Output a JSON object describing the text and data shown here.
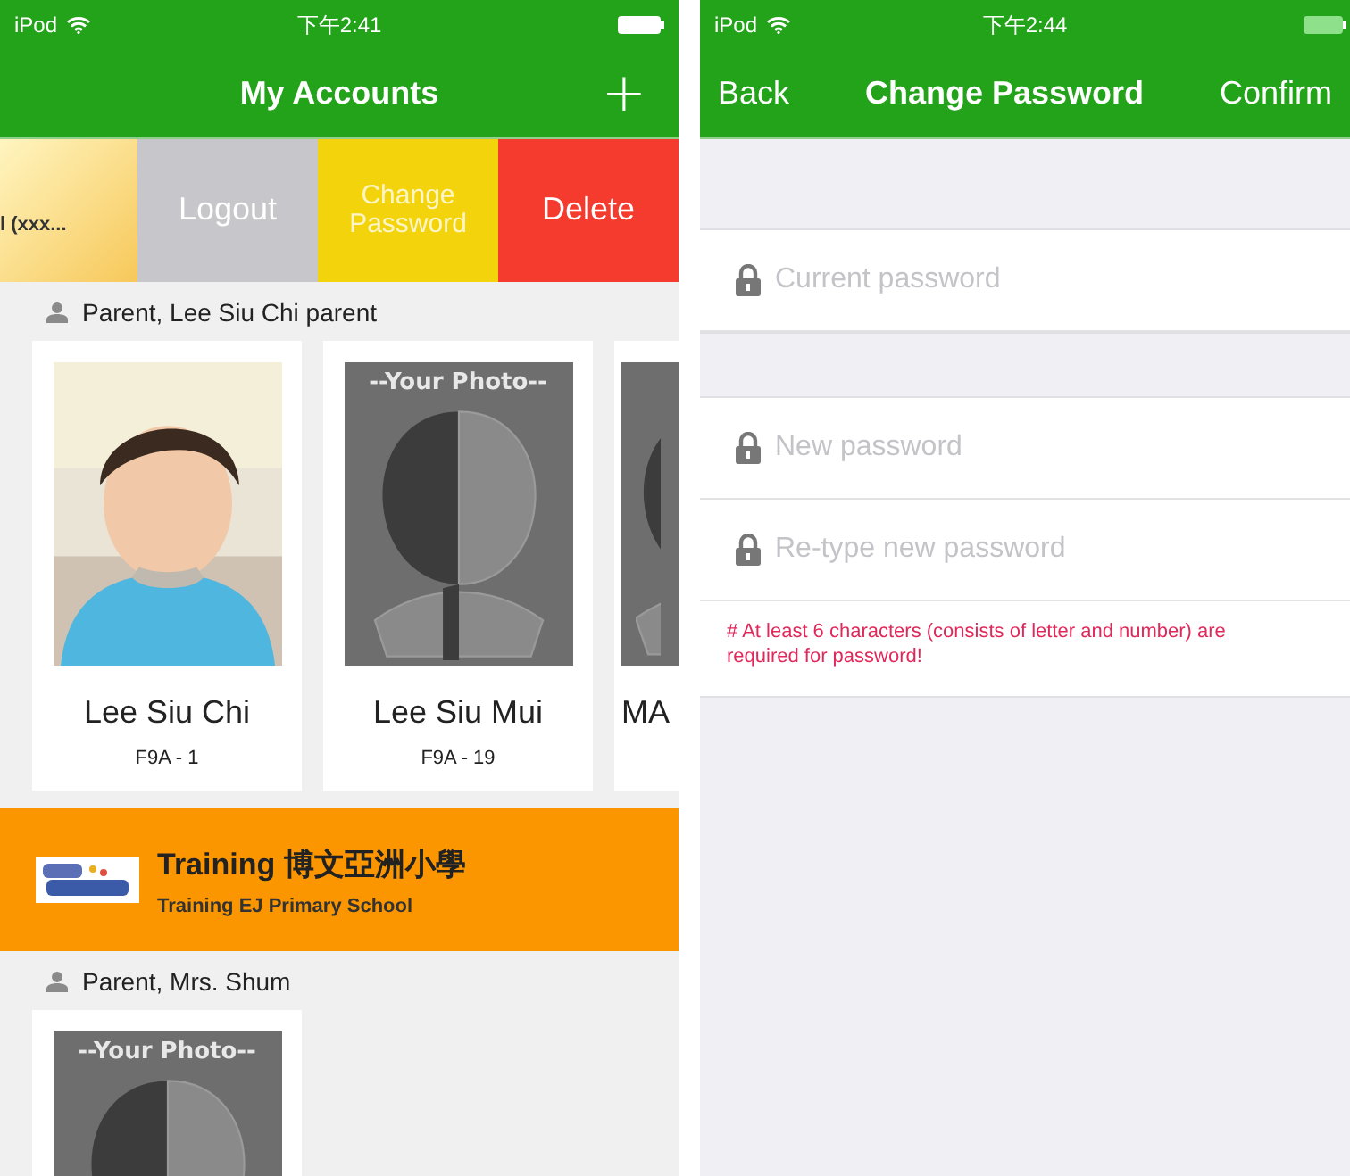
{
  "accounts_screen": {
    "status_bar": {
      "carrier": "iPod",
      "time": "下午2:41"
    },
    "title": "My Accounts",
    "add_button": "+",
    "swipe_row": {
      "partial_text": "l (xxx...",
      "actions": [
        {
          "label": "Logout",
          "color": "#c6c6cb"
        },
        {
          "label": "Change Password",
          "color": "#f3d40c"
        },
        {
          "label": "Delete",
          "color": "#f53b2d"
        }
      ]
    },
    "sections": [
      {
        "kind": "group",
        "header": "Parent, Lee Siu Chi parent",
        "students": [
          {
            "name": "Lee Siu Chi",
            "class": "F9A - 1",
            "kind": "picture"
          },
          {
            "name": "Lee Siu Mui",
            "class": "F9A - 19",
            "kind": "placeholder",
            "placeholder_text": "--Your Photo--"
          },
          {
            "name": "MA",
            "kind": "placeholder"
          }
        ]
      },
      {
        "kind": "school",
        "title": "Training 博文亞洲小學",
        "subtitle": "Training EJ Primary School"
      },
      {
        "kind": "group",
        "header": "Parent, Mrs. Shum",
        "students": [
          {
            "kind": "placeholder",
            "placeholder_text": "--Your Photo--"
          }
        ]
      }
    ]
  },
  "password_screen": {
    "status_bar": {
      "carrier": "iPod",
      "time": "下午2:44"
    },
    "back_button": "Back",
    "title": "Change Password",
    "confirm_button": "Confirm",
    "field_groups": [
      {
        "fields": [
          {
            "placeholder": "Current password"
          }
        ]
      },
      {
        "fields": [
          {
            "placeholder": "New password"
          },
          {
            "placeholder": "Re-type new password"
          }
        ],
        "hint": "# At least 6 characters (consists of letter and number) are required for password!"
      }
    ]
  }
}
